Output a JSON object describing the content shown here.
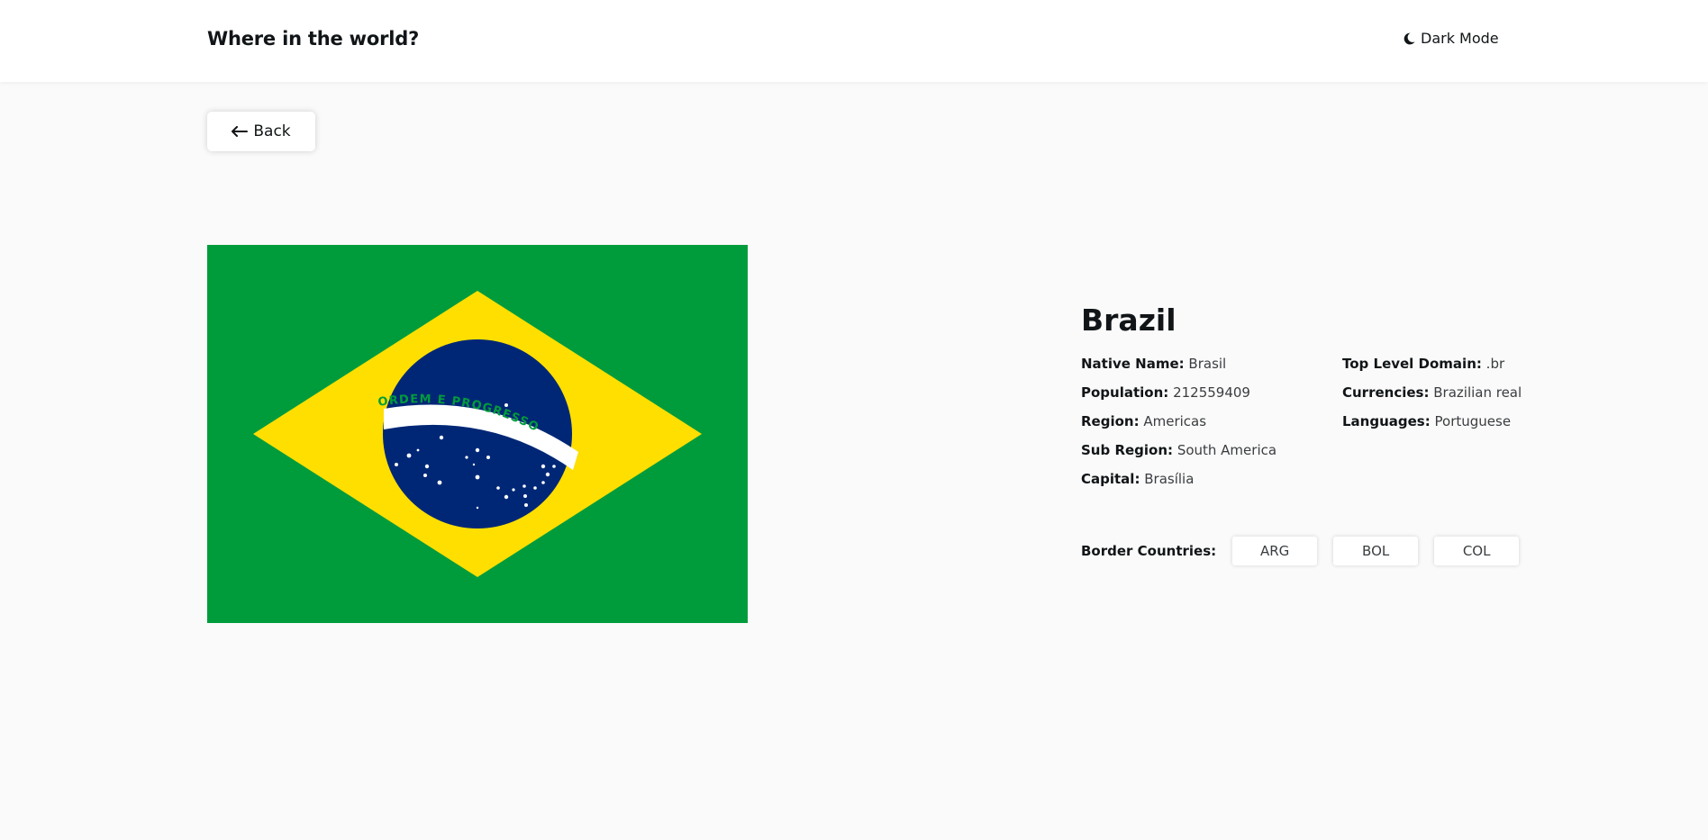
{
  "header": {
    "title": "Where in the world?",
    "dark_mode_label": "Dark Mode",
    "dark_mode_icon": "moon-icon"
  },
  "back_button": {
    "label": "Back",
    "icon": "arrow-left-icon"
  },
  "country": {
    "name": "Brazil",
    "flag_motto": "ORDEM E PROGRESSO",
    "left_details": [
      {
        "label": "Native Name:",
        "value": "Brasil"
      },
      {
        "label": "Population:",
        "value": "212559409"
      },
      {
        "label": "Region:",
        "value": "Americas"
      },
      {
        "label": "Sub Region:",
        "value": "South America"
      },
      {
        "label": "Capital:",
        "value": "Brasília"
      }
    ],
    "right_details": [
      {
        "label": "Top Level Domain:",
        "value": ".br"
      },
      {
        "label": "Currencies:",
        "value": "Brazilian real"
      },
      {
        "label": "Languages:",
        "value": "Portuguese"
      }
    ],
    "border_countries_label": "Border Countries:",
    "border_countries": [
      "ARG",
      "BOL",
      "COL"
    ]
  },
  "colors": {
    "background": "#fafafa",
    "header_bg": "#ffffff",
    "text": "#111517",
    "flag_green": "#009c3b",
    "flag_yellow": "#fedf00",
    "flag_blue": "#002776"
  }
}
